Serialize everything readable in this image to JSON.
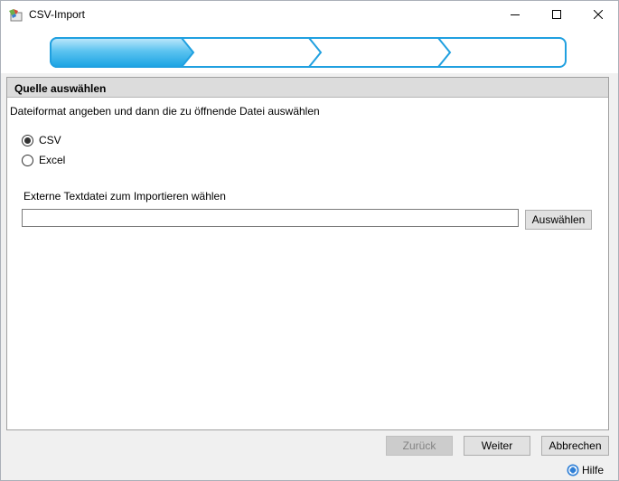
{
  "window": {
    "title": "CSV-Import",
    "app_icon": "import-wizard-icon",
    "controls": {
      "minimize_icon": "minimize-icon",
      "maximize_icon": "maximize-icon",
      "close_icon": "close-icon"
    }
  },
  "wizard": {
    "steps": [
      "",
      "",
      ""
    ],
    "active_step": 1,
    "colors": {
      "active": "#1aa3e3",
      "active_light": "#9fdcf7",
      "border": "#20a0e0"
    }
  },
  "panel": {
    "header": "Quelle auswählen",
    "instruction": "Dateiformat angeben und dann die zu öffnende Datei auswählen",
    "format_options": [
      {
        "label": "CSV",
        "checked": true
      },
      {
        "label": "Excel",
        "checked": false
      }
    ],
    "file_label": "Externe Textdatei zum Importieren wählen",
    "file_value": "",
    "browse_label": "Auswählen"
  },
  "footer": {
    "back_label": "Zurück",
    "next_label": "Weiter",
    "cancel_label": "Abbrechen",
    "help_label": "Hilfe",
    "help_icon": "help-icon"
  }
}
